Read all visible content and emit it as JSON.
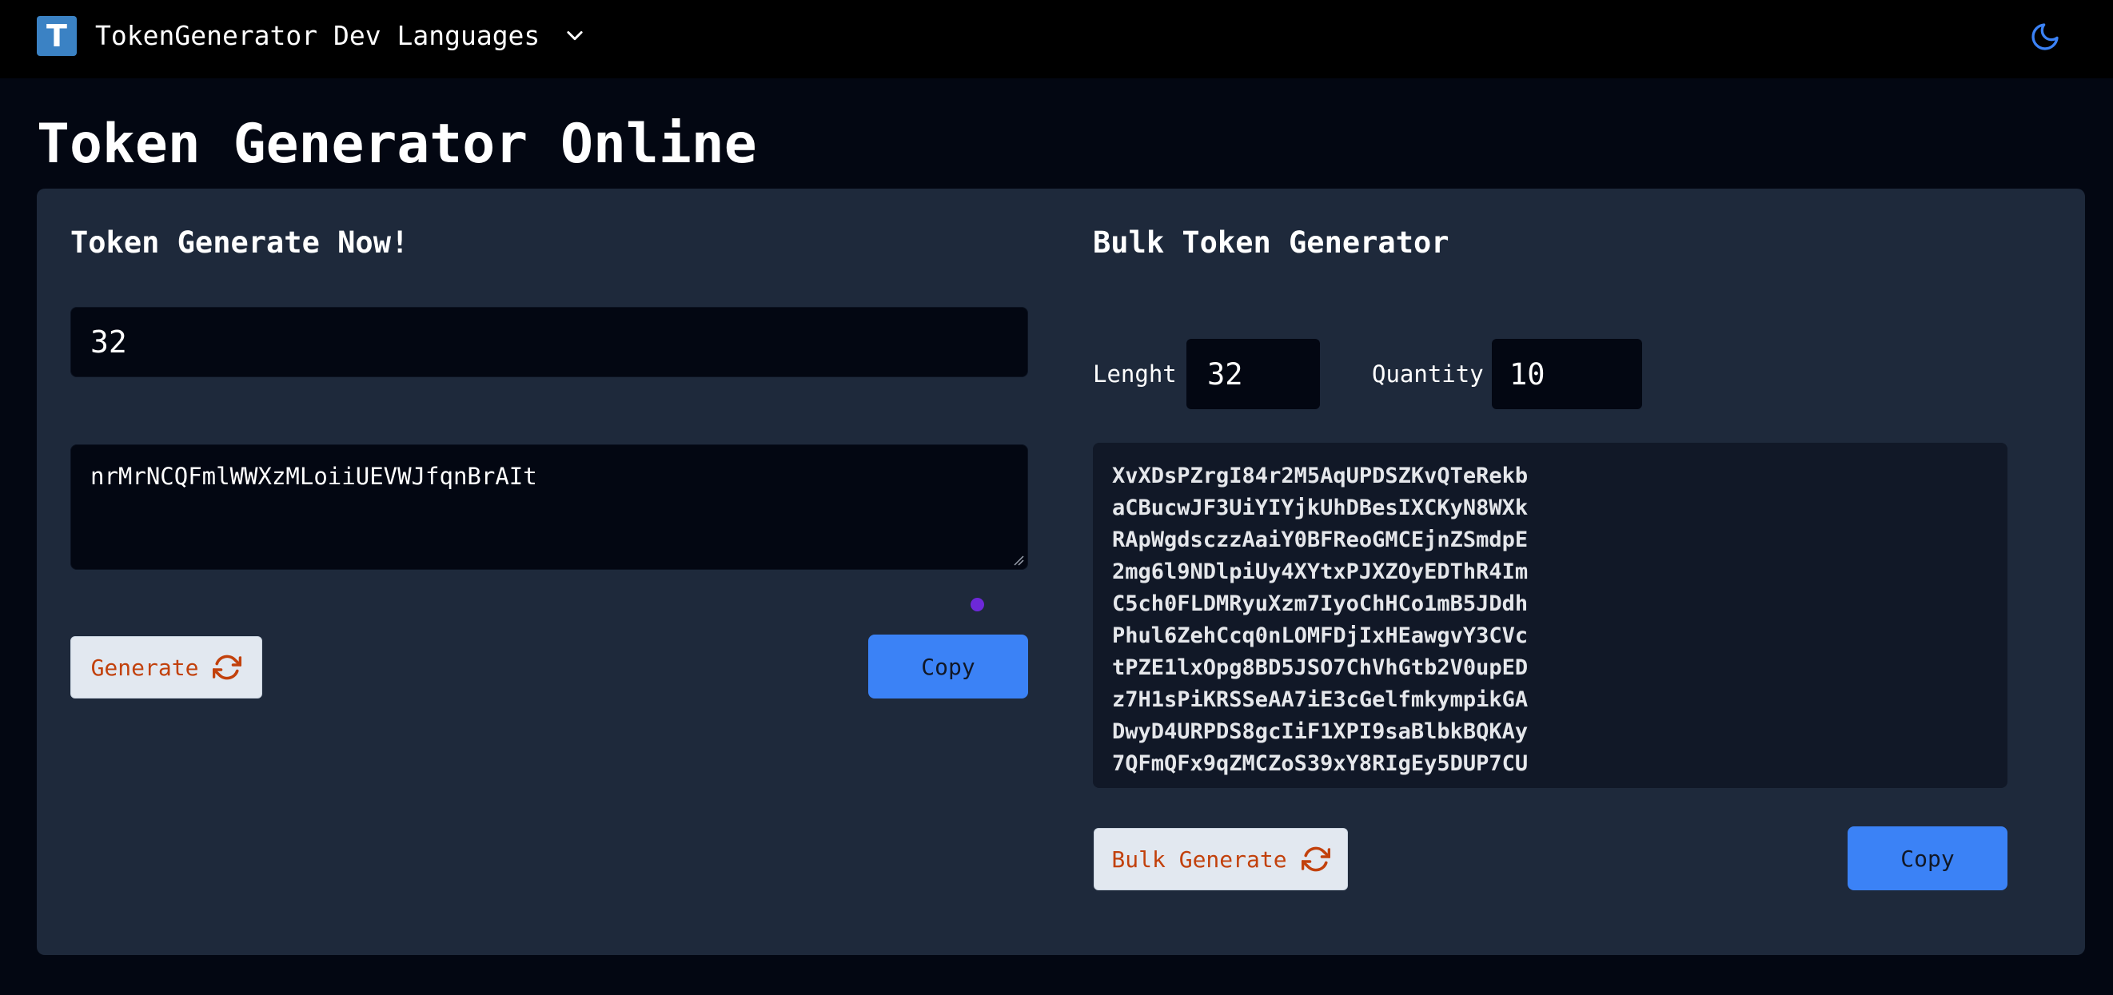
{
  "header": {
    "logo_letter": "T",
    "brand": "TokenGenerator Dev Languages",
    "icons": {
      "dropdown": "chevron-down-icon",
      "theme": "moon-icon"
    }
  },
  "page": {
    "title": "Token Generator Online"
  },
  "single": {
    "title": "Token Generate Now!",
    "length_value": "32",
    "token_value": "nrMrNCQFmlWWXzMLoiiUEVWJfqnBrAIt",
    "generate_label": "Generate",
    "copy_label": "Copy"
  },
  "bulk": {
    "title": "Bulk Token Generator",
    "length_label": "Lenght",
    "length_value": "32",
    "quantity_label": "Quantity",
    "quantity_value": "10",
    "tokens": [
      "XvXDsPZrgI84r2M5AqUPDSZKvQTeRekb",
      "aCBucwJF3UiYIYjkUhDBesIXCKyN8WXk",
      "RApWgdsczzAaiY0BFReoGMCEjnZSmdpE",
      "2mg6l9NDlpiUy4XYtxPJXZOyEDThR4Im",
      "C5ch0FLDMRyuXzm7IyoChHCo1mB5JDdh",
      "Phul6ZehCcq0nLOMFDjIxHEawgvY3CVc",
      "tPZE1lxOpg8BD5JSO7ChVhGtb2V0upED",
      "z7H1sPiKRSSeAA7iE3cGelfmkympikGA",
      "DwyD4URPDS8gcIiF1XPI9saBlbkBQKAy",
      "7QFmQFx9qZMCZoS39xY8RIgEy5DUP7CU"
    ],
    "generate_label": "Bulk Generate",
    "copy_label": "Copy"
  },
  "colors": {
    "background": "#030712",
    "card": "#1e293b",
    "accent_blue": "#3b82f6",
    "button_text_orange": "#c2410c"
  }
}
